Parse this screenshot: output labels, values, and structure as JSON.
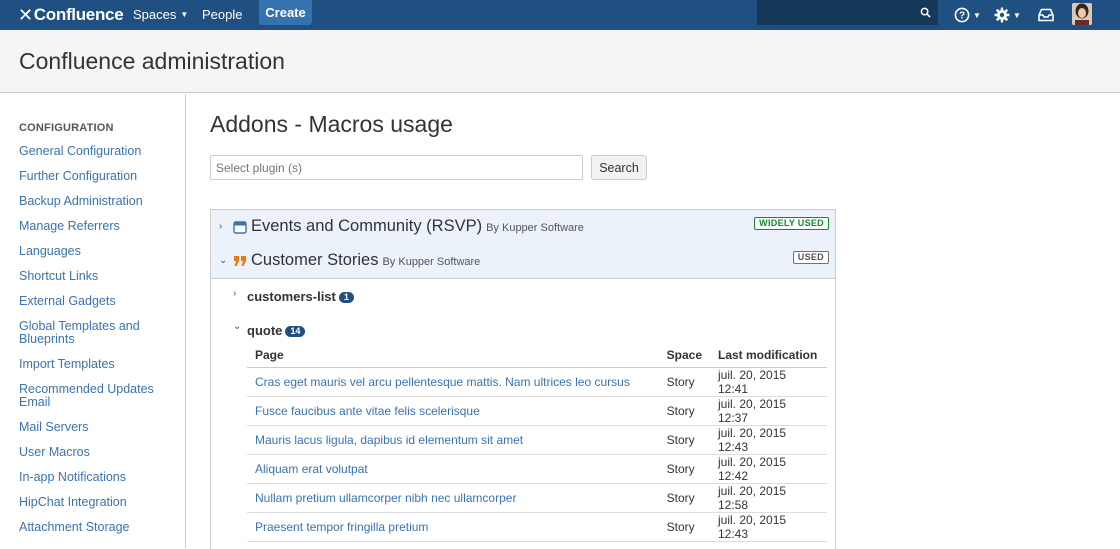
{
  "topnav": {
    "logo": "Confluence",
    "spaces": "Spaces",
    "people": "People",
    "create": "Create",
    "search_placeholder": ""
  },
  "header": {
    "title": "Confluence administration"
  },
  "sidebar": {
    "heading": "CONFIGURATION",
    "items": [
      "General Configuration",
      "Further Configuration",
      "Backup Administration",
      "Manage Referrers",
      "Languages",
      "Shortcut Links",
      "External Gadgets",
      "Global Templates and Blueprints",
      "Import Templates",
      "Recommended Updates Email",
      "Mail Servers",
      "User Macros",
      "In-app Notifications",
      "HipChat Integration",
      "Attachment Storage"
    ]
  },
  "main": {
    "title": "Addons - Macros usage",
    "plugin_placeholder": "Select plugin (s)",
    "search_label": "Search",
    "plugins": [
      {
        "name": "Events and Community (RSVP)",
        "by": "By Kupper Software",
        "badge": "WIDELY USED",
        "icon": "calendar-icon",
        "expanded": false
      },
      {
        "name": "Customer Stories",
        "by": "By Kupper Software",
        "badge": "USED",
        "icon": "quote-icon",
        "expanded": true
      }
    ],
    "macros": [
      {
        "name": "customers-list",
        "count": "1",
        "expanded": false
      },
      {
        "name": "quote",
        "count": "14",
        "expanded": true
      }
    ],
    "table": {
      "headers": [
        "Page",
        "Space",
        "Last modification"
      ],
      "rows": [
        [
          "Cras eget mauris vel arcu pellentesque mattis. Nam ultrices leo cursus",
          "Story",
          "juil. 20, 2015 12:41"
        ],
        [
          "Fusce faucibus ante vitae felis scelerisque",
          "Story",
          "juil. 20, 2015 12:37"
        ],
        [
          "Mauris lacus ligula, dapibus id elementum sit amet",
          "Story",
          "juil. 20, 2015 12:43"
        ],
        [
          "Aliquam erat volutpat",
          "Story",
          "juil. 20, 2015 12:42"
        ],
        [
          "Nullam pretium ullamcorper nibh nec ullamcorper",
          "Story",
          "juil. 20, 2015 12:58"
        ],
        [
          "Praesent tempor fringilla pretium",
          "Story",
          "juil. 20, 2015 12:43"
        ]
      ]
    }
  },
  "colors": {
    "nav": "#205081",
    "create": "#3572b0",
    "link": "#3b73af",
    "success": "#14892c"
  }
}
